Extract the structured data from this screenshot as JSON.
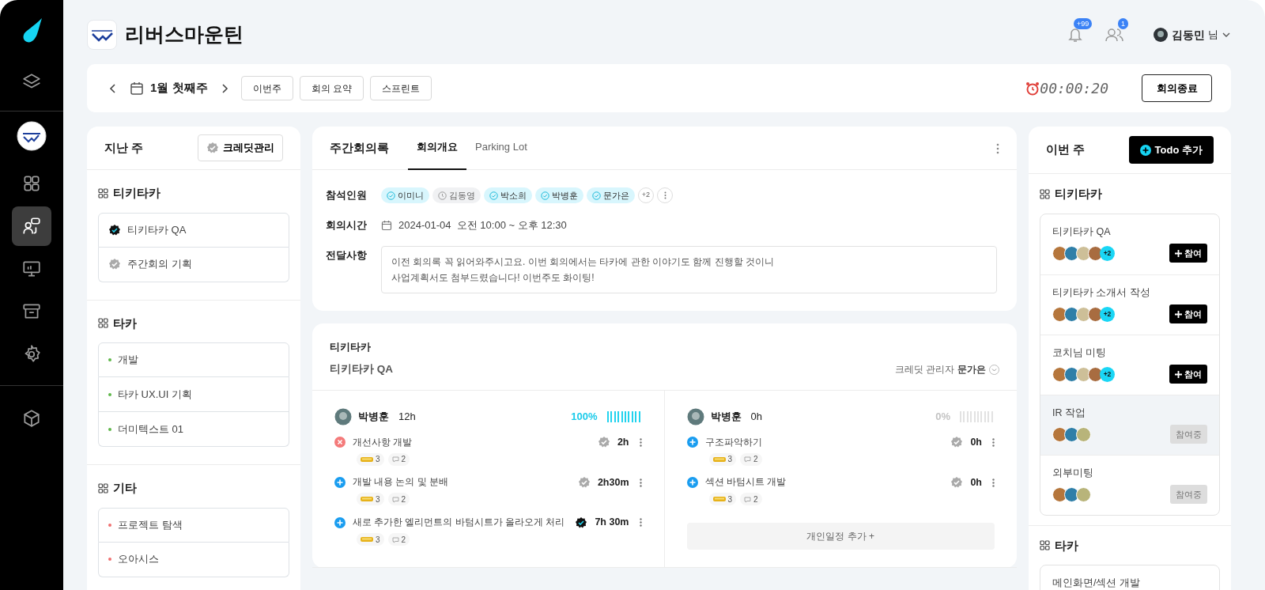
{
  "sidebar": {
    "top_items": [
      {
        "kind": "layers",
        "selected": false
      }
    ],
    "items": [
      {
        "kind": "dashboard",
        "selected": false
      },
      {
        "kind": "meeting",
        "selected": true
      },
      {
        "kind": "presentation",
        "selected": false
      },
      {
        "kind": "archive",
        "selected": false
      },
      {
        "kind": "settings",
        "selected": false
      }
    ],
    "bottom_items": [
      {
        "kind": "cube",
        "selected": false
      }
    ]
  },
  "header": {
    "company": "리버스마운틴",
    "notifications_badge": "+99",
    "friends_badge": "1",
    "user_name": "김동민",
    "user_suffix": "님"
  },
  "toolbar": {
    "week": "1월 첫째주",
    "buttons": [
      "이번주",
      "회의 요약",
      "스프린트"
    ],
    "timer": "00:00:20",
    "end_button": "회의종료"
  },
  "last_week": {
    "title": "지난 주",
    "credit_button": "크레딧관리",
    "groups": [
      {
        "name": "티키타카",
        "items": [
          {
            "kind": "badge",
            "label": "티키타카 QA",
            "done": true
          },
          {
            "kind": "badge",
            "label": "주간회의 기획",
            "done": false
          }
        ]
      },
      {
        "name": "타카",
        "items": [
          {
            "kind": "dot",
            "label": "개발",
            "color": "#5fb84a"
          },
          {
            "kind": "dot",
            "label": "타카 UX.UI 기획",
            "color": "#5fb84a"
          },
          {
            "kind": "dot",
            "label": "더미텍스트 01",
            "color": "#5fb84a"
          }
        ]
      },
      {
        "name": "기타",
        "items": [
          {
            "kind": "dot",
            "label": "프로젝트 탐색",
            "color": "#f07070"
          },
          {
            "kind": "dot",
            "label": "오아시스",
            "color": "#f07070"
          }
        ]
      }
    ]
  },
  "meeting": {
    "title": "주간회의록",
    "tabs": [
      {
        "label": "회의개요",
        "selected": true
      },
      {
        "label": "Parking Lot",
        "selected": false
      }
    ],
    "attendees_label": "참석인원",
    "attendees": [
      {
        "name": "이미니",
        "attended": true
      },
      {
        "name": "김동영",
        "attended": false
      },
      {
        "name": "박소희",
        "attended": true
      },
      {
        "name": "박병훈",
        "attended": true
      },
      {
        "name": "문가은",
        "attended": true
      }
    ],
    "attendees_more": "+2",
    "time_label": "회의시간",
    "time": "2024-01-04  오전 10:00 ~ 오후 12:30",
    "notice_label": "전달사항",
    "notice": "이전 회의록 꼭 읽어와주시고요. 이번 회의에서는 타카에 관한 이야기도 함께 진행할 것이니\n사업계획서도 첨부드렸습니다! 이번주도 화이팅!"
  },
  "project": {
    "group": "티키타카",
    "name": "티키타카 QA",
    "manager_label": "크레딧 관리자",
    "manager": "문가은",
    "members": [
      {
        "name": "박병훈",
        "hours": "12h",
        "percent": "100%",
        "level": 1,
        "tasks": [
          {
            "kind": "blocked",
            "title": "개선사항 개발",
            "verified": false,
            "time": "2h",
            "likes": "3",
            "comments": "2"
          },
          {
            "kind": "add",
            "title": "개발 내용 논의 및 분배",
            "verified": false,
            "time": "2h30m",
            "likes": "3",
            "comments": "2"
          },
          {
            "kind": "add",
            "title": "새로 추가한 엘리먼트의 바텀시트가 올라오게 처리",
            "verified": true,
            "time": "7h 30m",
            "likes": "3",
            "comments": "2"
          }
        ]
      },
      {
        "name": "박병훈",
        "hours": "0h",
        "percent": "0%",
        "level": 0,
        "tasks": [
          {
            "kind": "add",
            "title": "구조파악하기",
            "verified": false,
            "time": "0h",
            "likes": "3",
            "comments": "2"
          },
          {
            "kind": "add",
            "title": "섹션 바텀시트 개발",
            "verified": false,
            "time": "0h",
            "likes": "3",
            "comments": "2"
          }
        ],
        "add_button": "개인일정 추가 +"
      }
    ]
  },
  "this_week": {
    "title": "이번 주",
    "add_button": "Todo 추가",
    "groups": [
      {
        "name": "티키타카",
        "items": [
          {
            "title": "티키타카 QA",
            "selected": false,
            "avatars": [
              {
                "color": "#b5763c"
              },
              {
                "color": "#2f7fa8"
              },
              {
                "color": "#cdbf98"
              },
              {
                "color": "#a86c40"
              }
            ],
            "extra": "+2",
            "joined": false,
            "button": "참여"
          },
          {
            "title": "티키타카 소개서 작성",
            "selected": false,
            "avatars": [
              {
                "color": "#b5763c"
              },
              {
                "color": "#2f7fa8"
              },
              {
                "color": "#cdbf98"
              },
              {
                "color": "#a86c40"
              }
            ],
            "extra": "+2",
            "joined": false,
            "button": "참여"
          },
          {
            "title": "코치님 미팅",
            "selected": false,
            "avatars": [
              {
                "color": "#b5763c"
              },
              {
                "color": "#2f7fa8"
              },
              {
                "color": "#cdbf98"
              },
              {
                "color": "#a86c40"
              }
            ],
            "extra": "+2",
            "joined": false,
            "button": "참여"
          },
          {
            "title": "IR 작업",
            "selected": true,
            "avatars": [
              {
                "color": "#b5763c"
              },
              {
                "color": "#2f7fa8"
              },
              {
                "color": "#b8b47a"
              }
            ],
            "joined": true,
            "button": "참여중"
          },
          {
            "title": "외부미팅",
            "selected": false,
            "avatars": [
              {
                "color": "#b5763c"
              },
              {
                "color": "#2f7fa8"
              },
              {
                "color": "#b8b47a"
              }
            ],
            "joined": true,
            "button": "참여중"
          }
        ]
      },
      {
        "name": "타카",
        "items": [
          {
            "title": "메인화면/섹션 개발",
            "selected": false
          }
        ]
      }
    ]
  }
}
